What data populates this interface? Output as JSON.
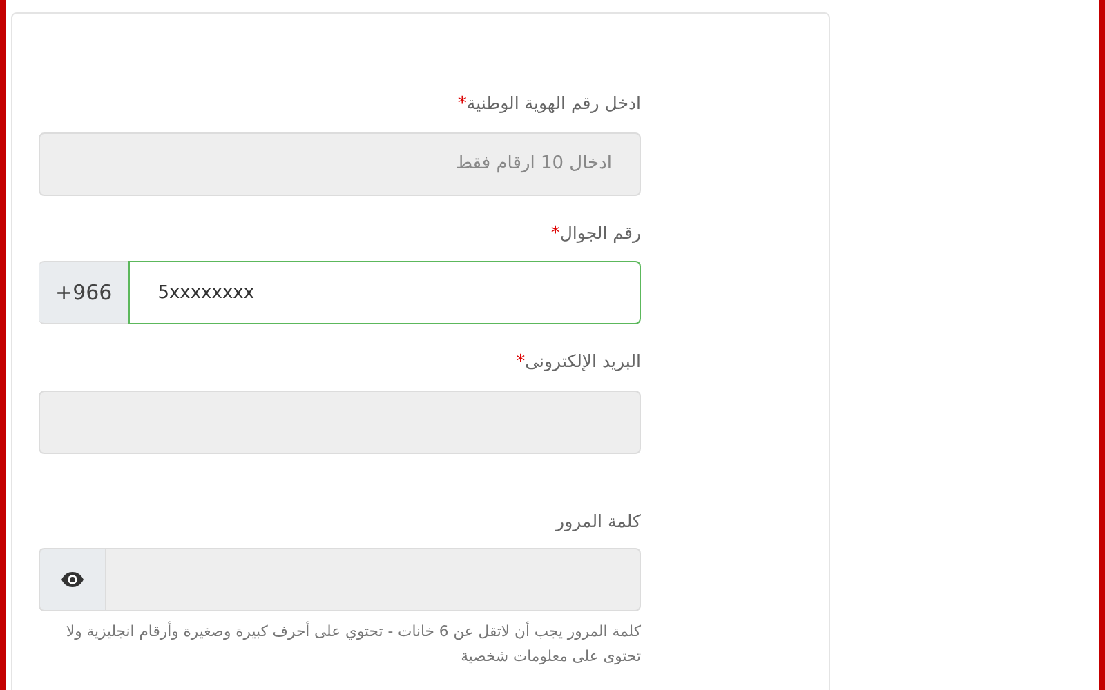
{
  "fields": [
    {
      "kind": "text",
      "label": "ادخل رقم الهوية الوطنية",
      "required_mark": "*",
      "placeholder": "ادخال 10 ارقام فقط",
      "focused": false
    },
    {
      "kind": "phone",
      "label": "رقم الجوال",
      "required_mark": "*",
      "prefix": "+966",
      "value": "5xxxxxxxx",
      "focused": true
    },
    {
      "kind": "text",
      "label": "البريد الإلكترونى",
      "required_mark": "*",
      "focused": false
    },
    {
      "kind": "password",
      "label": "كلمة المرور",
      "focused": false,
      "help": "كلمة المرور يجب أن لاتقل عن 6 خانات - تحتوي على أحرف كبيرة وصغيرة وأرقام انجليزية ولا تحتوى على معلومات شخصية"
    }
  ]
}
